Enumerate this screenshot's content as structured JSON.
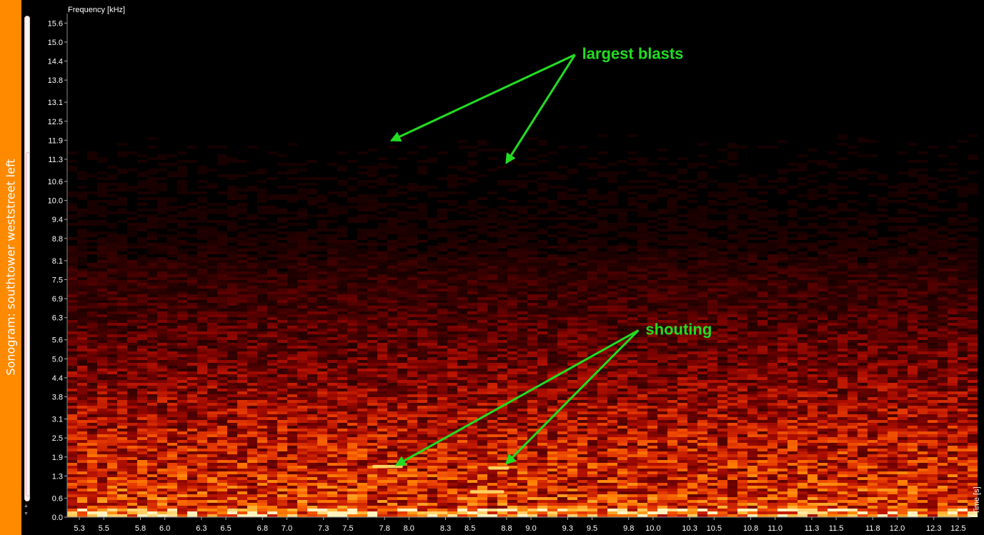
{
  "side_panel": {
    "title": "Sonogram: southtower weststreet left"
  },
  "chart_data": {
    "type": "heatmap",
    "title": "",
    "ylabel": "Frequency [kHz]",
    "xlabel": "Time [s]",
    "x_ticks": [
      "5.3",
      "5.5",
      "5.8",
      "6.0",
      "6.3",
      "6.5",
      "6.8",
      "7.0",
      "7.3",
      "7.5",
      "7.8",
      "8.0",
      "8.3",
      "8.5",
      "8.8",
      "9.0",
      "9.3",
      "9.5",
      "9.8",
      "10.0",
      "10.3",
      "10.5",
      "10.8",
      "11.0",
      "11.3",
      "11.5",
      "11.8",
      "12.0",
      "12.3",
      "12.5"
    ],
    "y_ticks": [
      "0.0",
      "0.6",
      "1.3",
      "1.9",
      "2.5",
      "3.1",
      "3.8",
      "4.4",
      "5.0",
      "5.6",
      "6.3",
      "6.9",
      "7.5",
      "8.1",
      "8.8",
      "9.4",
      "10.0",
      "10.6",
      "11.3",
      "11.9",
      "12.5",
      "13.1",
      "13.8",
      "14.4",
      "15.0",
      "15.6"
    ],
    "xlim": [
      5.2,
      12.6
    ],
    "ylim": [
      0.0,
      15.9
    ],
    "colormap": [
      "#000000",
      "#2a0000",
      "#6e0000",
      "#b31000",
      "#e63a00",
      "#ff7a00",
      "#ffc040",
      "#fff3c0"
    ],
    "annotations": [
      {
        "text": "largest blasts",
        "from": [
          9.36,
          14.6
        ],
        "to": [
          [
            7.86,
            11.9
          ],
          [
            8.8,
            11.2
          ]
        ]
      },
      {
        "text": "shouting",
        "from": [
          9.88,
          5.9
        ],
        "to": [
          [
            7.9,
            1.65
          ],
          [
            8.8,
            1.7
          ]
        ]
      }
    ],
    "bright_features": [
      {
        "x": [
          8.65,
          8.82
        ],
        "y": [
          1.5,
          1.6
        ]
      },
      {
        "x": [
          8.5,
          8.78
        ],
        "y": [
          0.75,
          0.85
        ]
      },
      {
        "x": [
          7.7,
          7.95
        ],
        "y": [
          1.55,
          1.65
        ]
      }
    ]
  }
}
